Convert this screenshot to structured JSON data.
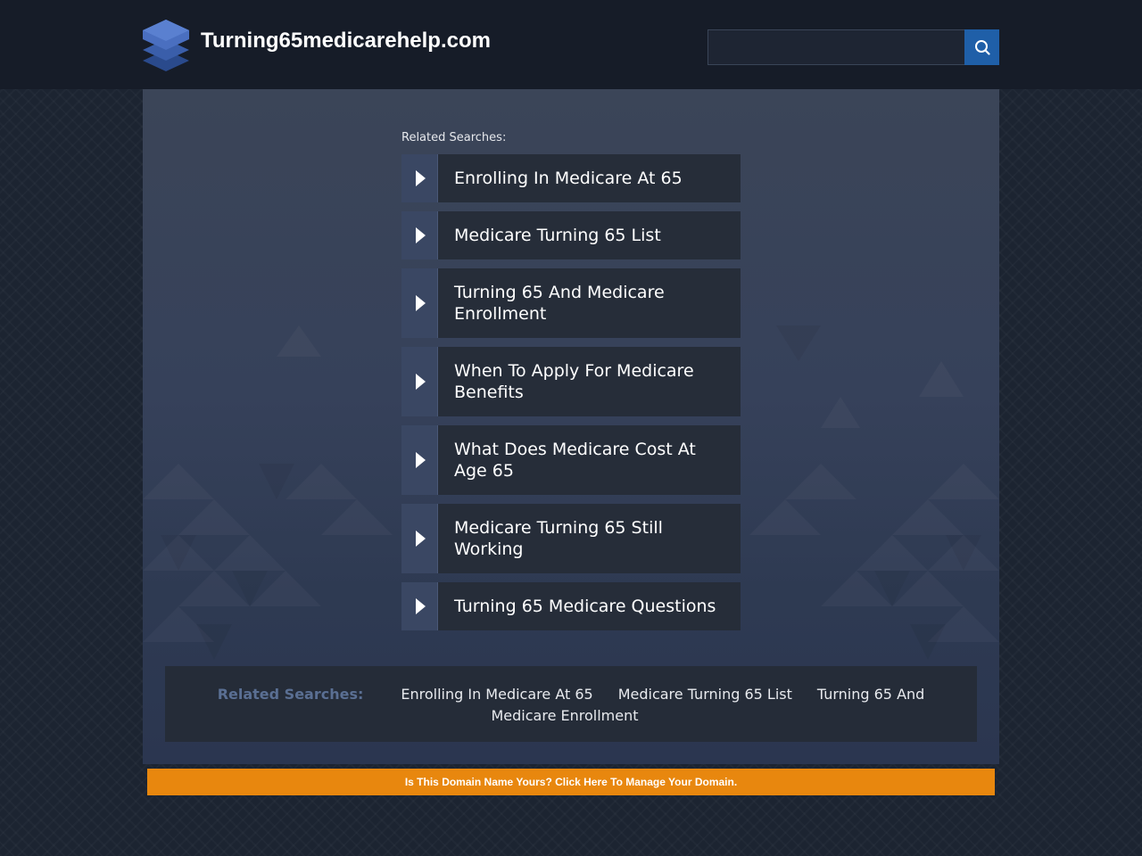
{
  "header": {
    "site_title": "Turning65medicarehelp.com",
    "logo_icon": "stacked-layers-icon",
    "search": {
      "value": "",
      "placeholder": "",
      "button_icon": "search-icon"
    }
  },
  "main": {
    "related_label": "Related Searches:",
    "links": [
      "Enrolling In Medicare At 65",
      "Medicare Turning 65 List",
      "Turning 65 And Medicare Enrollment",
      "When To Apply For Medicare Benefits",
      "What Does Medicare Cost At Age 65",
      "Medicare Turning 65 Still Working",
      "Turning 65 Medicare Questions"
    ]
  },
  "footer": {
    "label": "Related Searches:",
    "links": [
      "Enrolling In Medicare At 65",
      "Medicare Turning 65 List",
      "Turning 65 And Medicare Enrollment"
    ]
  },
  "domain_bar": {
    "text": "Is This Domain Name Yours? Click Here To Manage Your Domain."
  },
  "colors": {
    "accent": "#1f5fa8",
    "orange": "#e8870e",
    "panel": "#3b4558"
  }
}
